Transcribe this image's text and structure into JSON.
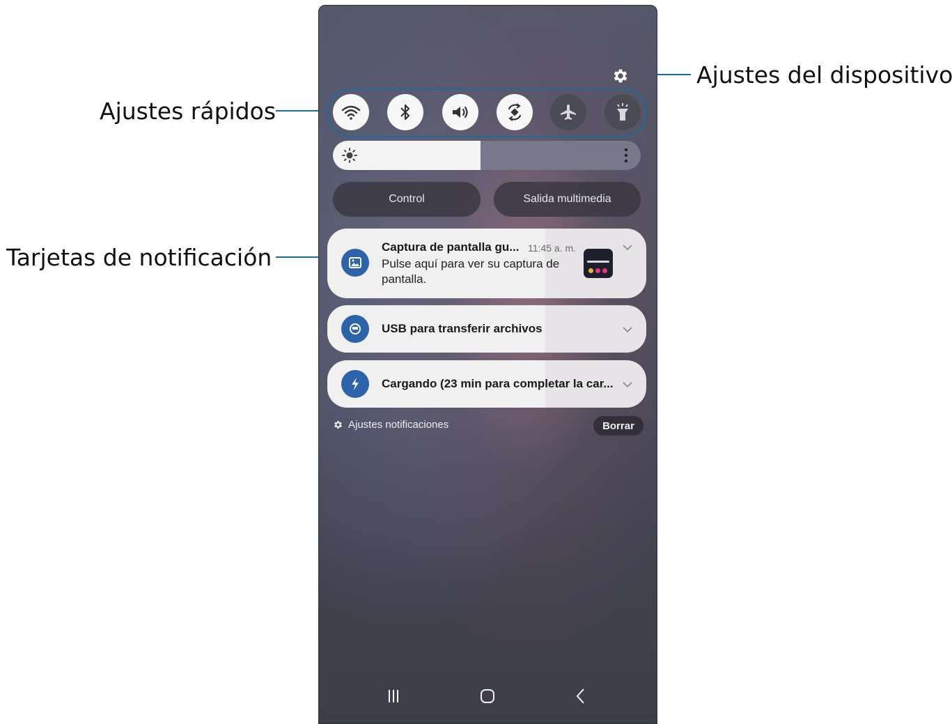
{
  "callouts": {
    "device_settings": "Ajustes del dispositivo",
    "quick_settings": "Ajustes rápidos",
    "notification_cards": "Tarjetas de notificación"
  },
  "quick_settings": {
    "buttons": [
      {
        "name": "wifi",
        "icon": "wifi-icon",
        "state": "on"
      },
      {
        "name": "bluetooth",
        "icon": "bluetooth-icon",
        "state": "on"
      },
      {
        "name": "sound",
        "icon": "sound-icon",
        "state": "on"
      },
      {
        "name": "auto-rotate",
        "icon": "rotate-icon",
        "state": "on"
      },
      {
        "name": "airplane",
        "icon": "airplane-icon",
        "state": "off"
      },
      {
        "name": "flashlight",
        "icon": "flashlight-icon",
        "state": "off"
      }
    ],
    "brightness_level": 0.48
  },
  "pills": {
    "control": "Control",
    "media_output": "Salida multimedia"
  },
  "notifications": [
    {
      "title": "Captura de pantalla gu...",
      "time": "11:45 a. m.",
      "body": "Pulse aquí para ver su captura de pantalla.",
      "icon": "gallery-icon"
    },
    {
      "title": "USB para transferir archivos",
      "icon": "usb-icon"
    },
    {
      "title": "Cargando (23 min para completar la car...",
      "icon": "charging-icon"
    }
  ],
  "footer": {
    "settings_label": "Ajustes notificaciones",
    "clear_label": "Borrar"
  },
  "navigation": [
    "recents-icon",
    "home-icon",
    "back-icon"
  ],
  "colors": {
    "accent_blue": "#1f6a99",
    "notification_icon": "#2d63a9",
    "quick_on": "#f7f7f7",
    "quick_off": "#4a4b57"
  }
}
